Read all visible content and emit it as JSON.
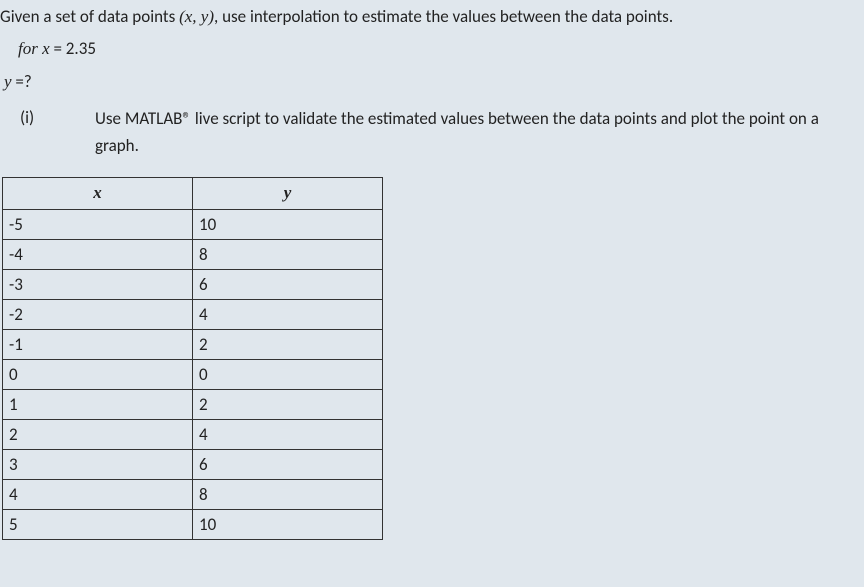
{
  "problem": {
    "intro": "Given a set of data points (x, y),  use interpolation to estimate the values between the data points.",
    "forx_label": "for x",
    "forx_value": " = 2.35",
    "y_label": "y",
    "y_value": " =?",
    "part_label": "(i)",
    "part_text": "Use MATLAB® live script to validate the estimated values between the data points and plot the point on a graph."
  },
  "table": {
    "headers": {
      "x": "x",
      "y": "y"
    },
    "rows": [
      {
        "x": "-5",
        "y": "10"
      },
      {
        "x": "-4",
        "y": "8"
      },
      {
        "x": "-3",
        "y": "6"
      },
      {
        "x": "-2",
        "y": "4"
      },
      {
        "x": "-1",
        "y": "2"
      },
      {
        "x": "0",
        "y": "0"
      },
      {
        "x": "1",
        "y": "2"
      },
      {
        "x": "2",
        "y": "4"
      },
      {
        "x": "3",
        "y": "6"
      },
      {
        "x": "4",
        "y": "8"
      },
      {
        "x": "5",
        "y": "10"
      }
    ]
  }
}
